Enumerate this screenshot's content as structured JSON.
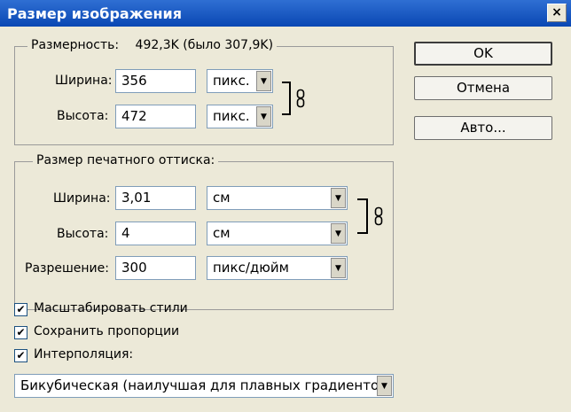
{
  "window": {
    "title": "Размер изображения",
    "close": "×"
  },
  "dimensions": {
    "label": "Размерность:",
    "value": "492,3K (было 307,9K)",
    "width": {
      "label": "Ширина:",
      "value": "356",
      "unit": "пикс."
    },
    "height": {
      "label": "Высота:",
      "value": "472",
      "unit": "пикс."
    }
  },
  "print": {
    "legend": "Размер печатного оттиска:",
    "width": {
      "label": "Ширина:",
      "value": "3,01",
      "unit": "см"
    },
    "height": {
      "label": "Высота:",
      "value": "4",
      "unit": "см"
    },
    "resolution": {
      "label": "Разрешение:",
      "value": "300",
      "unit": "пикс/дюйм"
    }
  },
  "buttons": {
    "ok": "OK",
    "cancel": "Отмена",
    "auto": "Авто..."
  },
  "options": {
    "scale_styles": {
      "label": "Масштабировать стили",
      "checked": true
    },
    "constrain": {
      "label": "Сохранить пропорции",
      "checked": true
    },
    "resample": {
      "label": "Интерполяция:",
      "checked": true
    }
  },
  "interpolation": {
    "value": "Бикубическая (наилучшая для плавных градиентов)"
  },
  "icons": {
    "check": "✔",
    "arrow": "▼",
    "link": "chain-link-icon"
  }
}
